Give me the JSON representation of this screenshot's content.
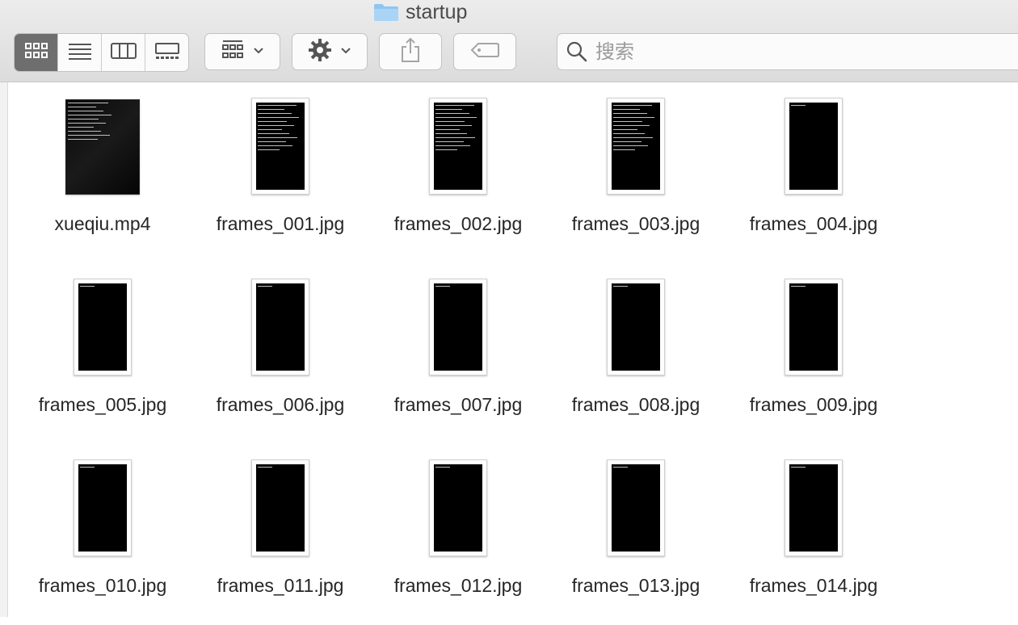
{
  "window": {
    "title": "startup",
    "folder_icon": "folder-icon"
  },
  "toolbar": {
    "view_buttons": [
      {
        "name": "icon-view-button",
        "icon": "grid-icon",
        "active": true
      },
      {
        "name": "list-view-button",
        "icon": "list-icon",
        "active": false
      },
      {
        "name": "column-view-button",
        "icon": "columns-icon",
        "active": false
      },
      {
        "name": "gallery-view-button",
        "icon": "gallery-icon",
        "active": false
      }
    ],
    "group_icon": "group-icon",
    "action_icon": "gear-icon",
    "share_icon": "share-icon",
    "tag_icon": "tag-icon"
  },
  "search": {
    "placeholder": "搜索",
    "value": ""
  },
  "files": [
    {
      "name": "xueqiu.mp4",
      "type": "video"
    },
    {
      "name": "frames_001.jpg",
      "type": "image",
      "lines": 12
    },
    {
      "name": "frames_002.jpg",
      "type": "image",
      "lines": 12
    },
    {
      "name": "frames_003.jpg",
      "type": "image",
      "lines": 12
    },
    {
      "name": "frames_004.jpg",
      "type": "image",
      "lines": 1
    },
    {
      "name": "frames_005.jpg",
      "type": "image",
      "lines": 1
    },
    {
      "name": "frames_006.jpg",
      "type": "image",
      "lines": 1
    },
    {
      "name": "frames_007.jpg",
      "type": "image",
      "lines": 1
    },
    {
      "name": "frames_008.jpg",
      "type": "image",
      "lines": 1
    },
    {
      "name": "frames_009.jpg",
      "type": "image",
      "lines": 1
    },
    {
      "name": "frames_010.jpg",
      "type": "image",
      "lines": 1
    },
    {
      "name": "frames_011.jpg",
      "type": "image",
      "lines": 1
    },
    {
      "name": "frames_012.jpg",
      "type": "image",
      "lines": 1
    },
    {
      "name": "frames_013.jpg",
      "type": "image",
      "lines": 1
    },
    {
      "name": "frames_014.jpg",
      "type": "image",
      "lines": 1
    }
  ]
}
